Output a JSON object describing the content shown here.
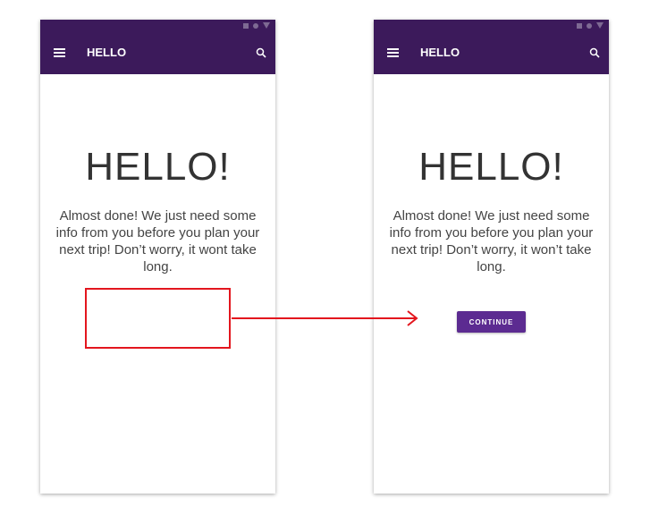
{
  "before": {
    "app_title": "HELLO",
    "heading": "HELLO!",
    "message": "Almost done! We just need some info from you before you plan your next trip! Don’t worry, it wont take long."
  },
  "after": {
    "app_title": "HELLO",
    "heading": "HELLO!",
    "message": "Almost done! We just need some info from you before you plan your next trip! Don’t worry, it won’t take long.",
    "continue_label": "CONTINUE"
  },
  "icons": {
    "menu": "menu-icon",
    "search": "search-icon",
    "status": [
      "square-icon",
      "circle-icon",
      "triangle-icon"
    ]
  },
  "colors": {
    "app_bar": "#3c1a5b",
    "button": "#5c2b91",
    "annotation": "#e3161e"
  }
}
